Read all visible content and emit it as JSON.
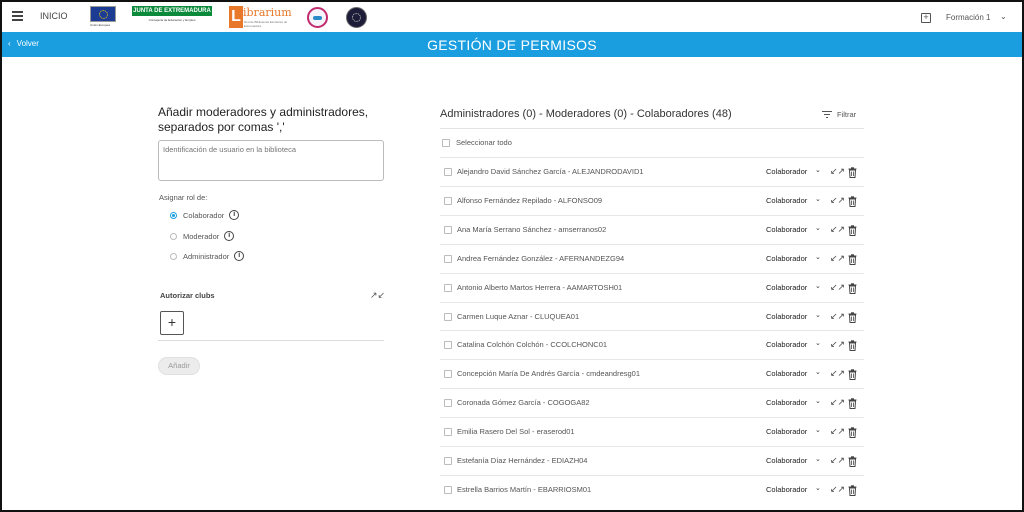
{
  "nav": {
    "inicio": "INICIO",
    "eu_logo_caption": "Unión Europea",
    "junta_logo_text": "JUNTA DE EXTREMADURA",
    "junta_logo_caption": "Consejería de Educación y Empleo",
    "librarium_logo_initial": "L",
    "librarium_logo_word": "ibrarium",
    "librarium_logo_tagline": "Red de Bibliotecas Escolares de Extremadura",
    "account": "Formación 1",
    "icons": {
      "menu": "hamburger-icon",
      "add": "plus-square-icon",
      "account_dropdown": "chevron-down-icon"
    }
  },
  "band": {
    "back_label": "Volver",
    "title": "GESTIÓN DE PERMISOS",
    "color": "#1a9ee0"
  },
  "form": {
    "title": "Añadir moderadores y administradores, separados por comas ','",
    "user_placeholder": "Identificación de usuario en la biblioteca",
    "assign_role_label": "Asignar rol de:",
    "roles": [
      {
        "label": "Colaborador",
        "checked": true
      },
      {
        "label": "Moderador",
        "checked": false
      },
      {
        "label": "Administrador",
        "checked": false
      }
    ],
    "clubs_label": "Autorizar clubs",
    "add_club_symbol": "+",
    "submit_label": "Añadir"
  },
  "list": {
    "header": "Administradores (0) - Moderadores (0) - Colaboradores (48)",
    "filter_label": "Filtrar",
    "select_all_label": "Seleccionar todo",
    "members": [
      {
        "name": "Alejandro David Sánchez García - ALEJANDRODAVID1",
        "role": "Colaborador"
      },
      {
        "name": "Alfonso Fernández Repilado - ALFONSO09",
        "role": "Colaborador"
      },
      {
        "name": "Ana María Serrano Sánchez - amserranos02",
        "role": "Colaborador"
      },
      {
        "name": "Andrea Fernández González - AFERNANDEZG94",
        "role": "Colaborador"
      },
      {
        "name": "Antonio Alberto Martos Herrera - AAMARTOSH01",
        "role": "Colaborador"
      },
      {
        "name": "Carmen Luque Aznar - CLUQUEA01",
        "role": "Colaborador"
      },
      {
        "name": "Catalina Colchón Colchón - CCOLCHONC01",
        "role": "Colaborador"
      },
      {
        "name": "Concepción María De Andrés García - cmdeandresg01",
        "role": "Colaborador"
      },
      {
        "name": "Coronada Gómez García - COGOGA82",
        "role": "Colaborador"
      },
      {
        "name": "Emilia Rasero Del Sol - eraserod01",
        "role": "Colaborador"
      },
      {
        "name": "Estefanía Díaz Hernández - EDIAZH04",
        "role": "Colaborador"
      },
      {
        "name": "Estrella Barrios Martín - EBARRIOSM01",
        "role": "Colaborador"
      }
    ]
  }
}
